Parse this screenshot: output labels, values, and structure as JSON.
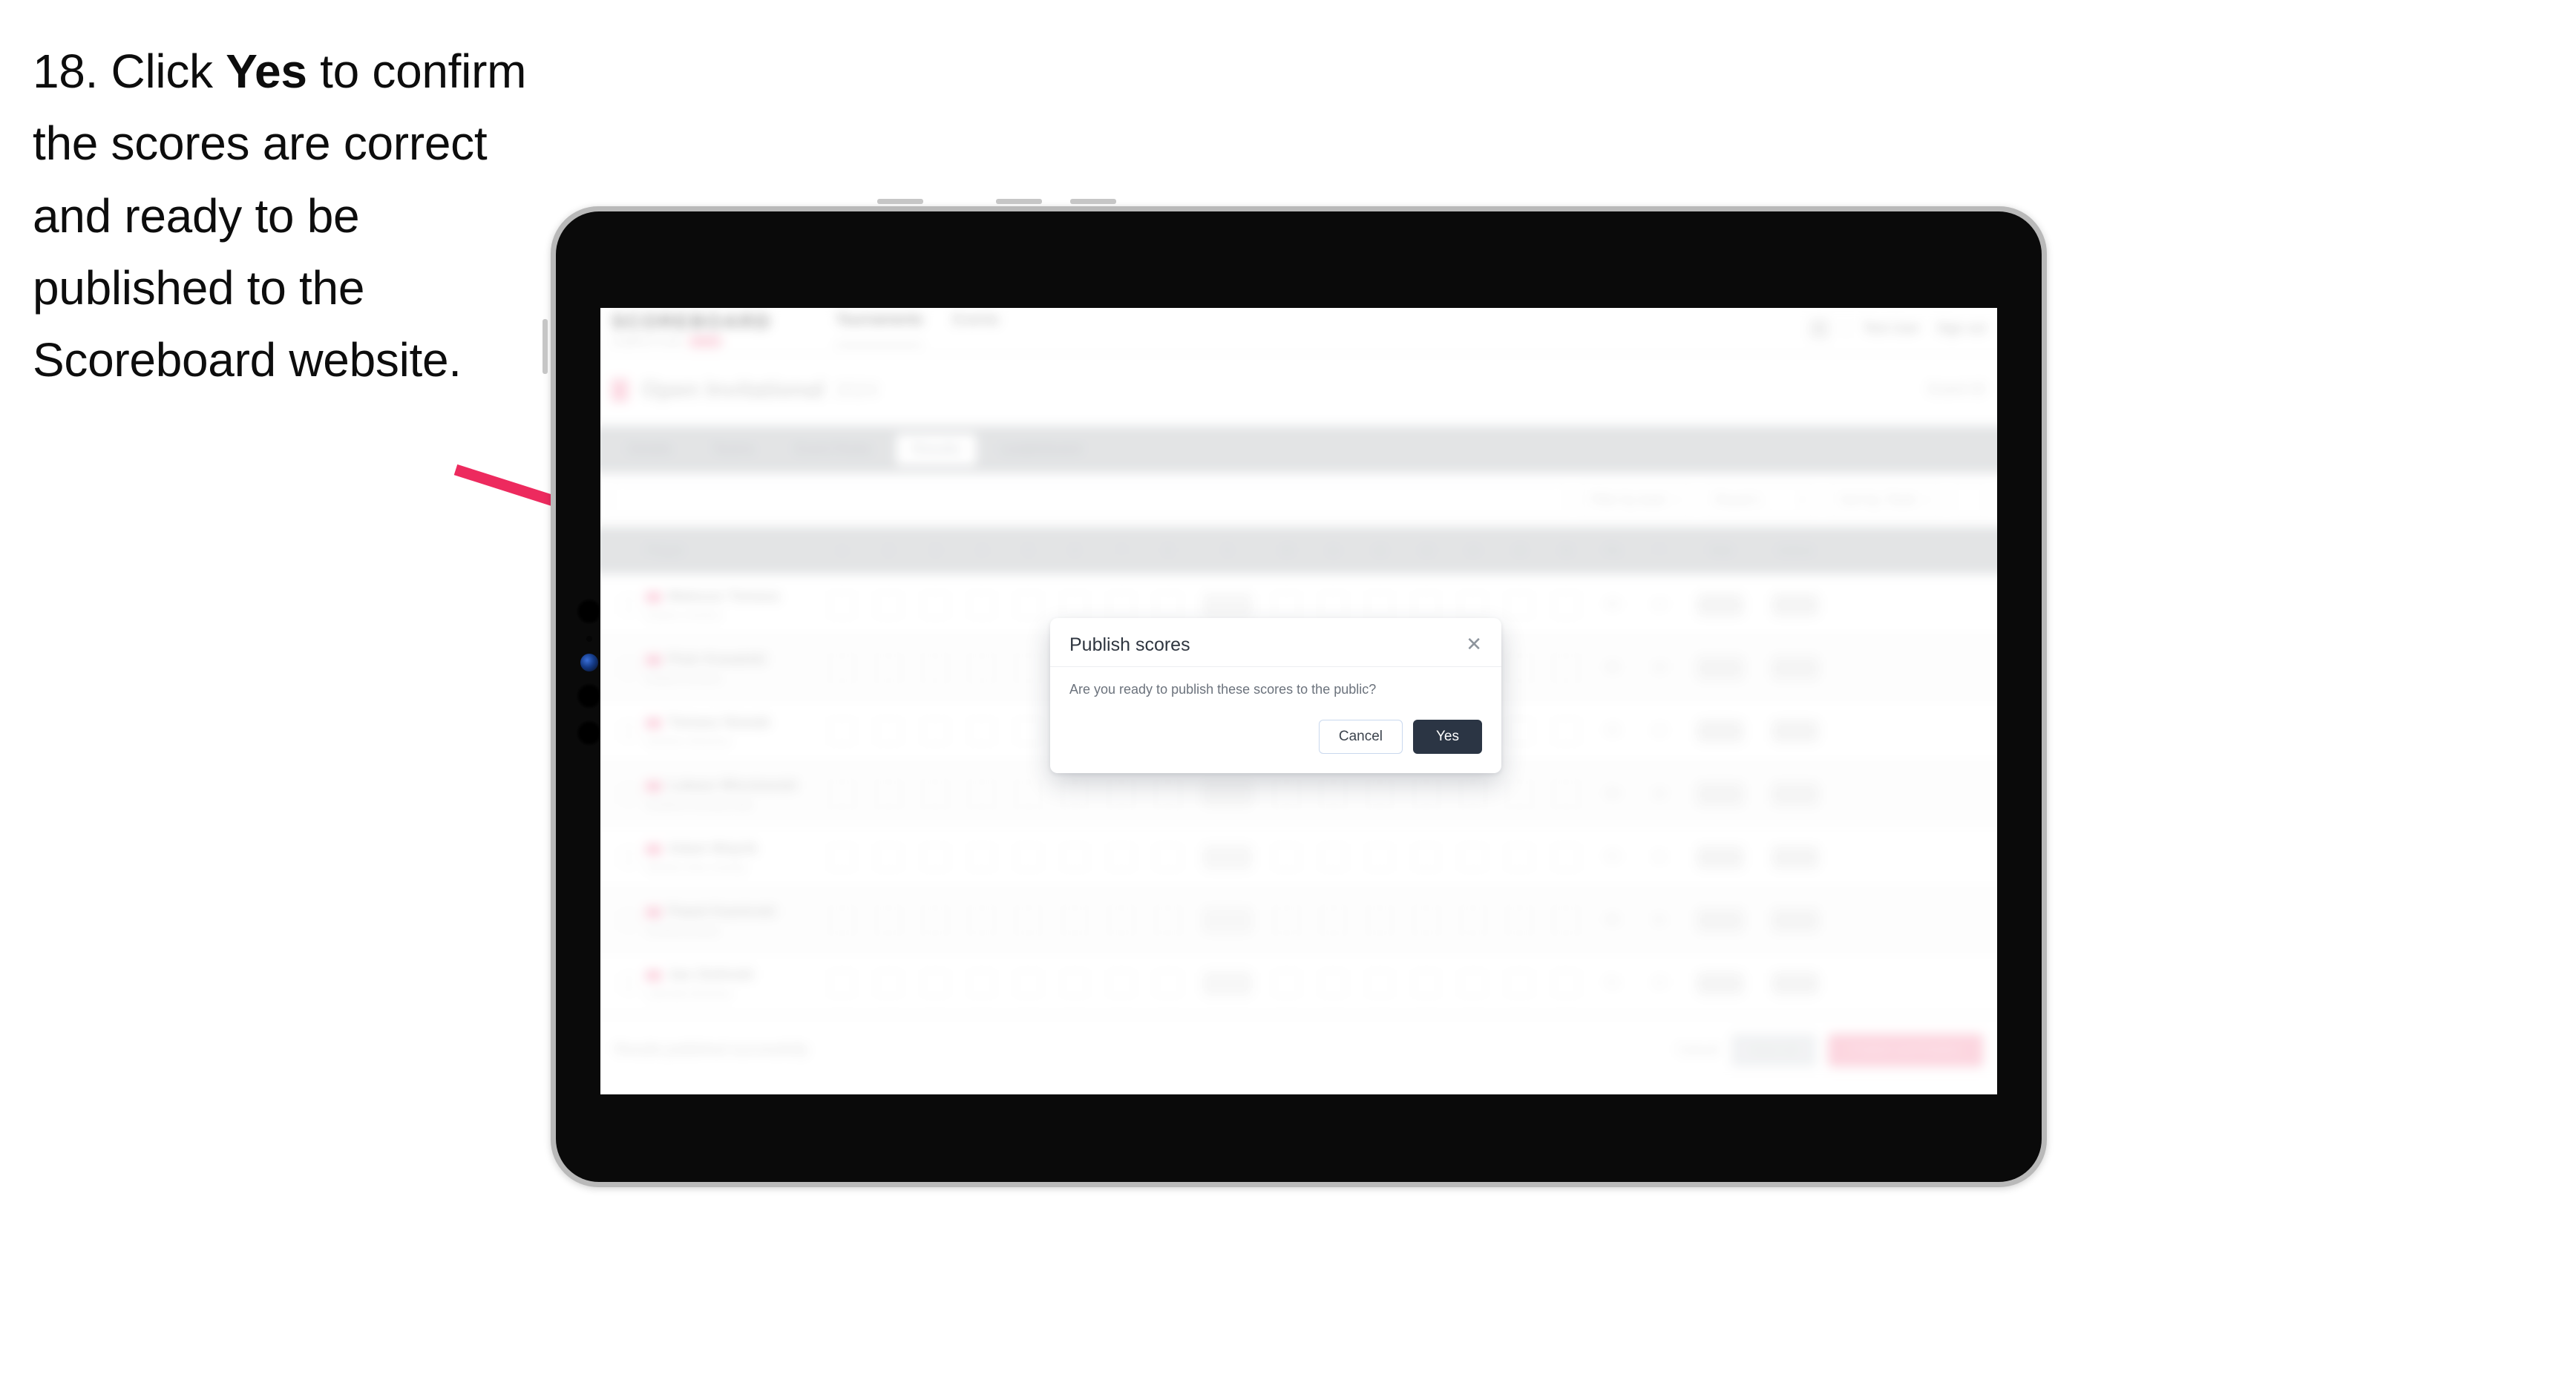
{
  "instruction": {
    "step_number": "18.",
    "before_bold": " Click ",
    "bold": "Yes",
    "after_bold": " to confirm the scores are correct and ready to be published to the Scoreboard website."
  },
  "annotation": {
    "arrow_color": "#ED2A5E",
    "arrow_name": "pointer-arrow"
  },
  "device": {
    "name": "tablet",
    "bezel_color": "#0a0a0a",
    "frame_color": "#b9b9b9"
  },
  "app": {
    "brand": {
      "name": "SCOREBOARD",
      "subtitle": "COMPETITION",
      "badge": "BETA"
    },
    "topnav": [
      {
        "label": "Tournaments"
      },
      {
        "label": "Events"
      }
    ],
    "topbar_right": {
      "user": "Test User",
      "signout": "Sign out"
    },
    "event": {
      "title": "Open Invitational",
      "subtitle": "2024",
      "right_label": "Event ID"
    },
    "tabs": [
      {
        "label": "Details"
      },
      {
        "label": "Teams"
      },
      {
        "label": "Event Rules"
      },
      {
        "label": "Results"
      },
      {
        "label": "Leaderboard"
      }
    ],
    "active_tab": "Results",
    "filters": {
      "search_placeholder": "Search",
      "selects": [
        {
          "label": "Filter by team",
          "caret": "▾"
        },
        {
          "label": "Round 1",
          "caret": "▾"
        },
        {
          "label": "Sort by: Rank",
          "caret": "▾"
        }
      ],
      "icon_button": "options-icon"
    },
    "table": {
      "headers": [
        "",
        "Player",
        "1",
        "2",
        "3",
        "4",
        "5",
        "6",
        "7",
        "8",
        "9",
        "10",
        "11",
        "12",
        "13",
        "14",
        "15",
        "16",
        "Pts",
        "T",
        "Total",
        "Actions"
      ],
      "rows": [
        {
          "name": "Mateusz Tomasz",
          "club": "Eastern Archers",
          "scores": [
            "8",
            "9",
            "8",
            "9",
            "7",
            "8",
            "9",
            "8",
            "9",
            "7",
            "8",
            "9",
            "8",
            "9",
            "7",
            "8"
          ],
          "pts": "88",
          "t": "14",
          "total": "270"
        },
        {
          "name": "Piotr Kowalski",
          "club": "Eastern Archers",
          "scores": [
            "9",
            "8",
            "9",
            "8",
            "9",
            "7",
            "8",
            "9",
            "8",
            "9",
            "7",
            "8",
            "9",
            "8",
            "9",
            "8"
          ],
          "pts": "86",
          "t": "13",
          "total": "268"
        },
        {
          "name": "Tomasz Nowak",
          "club": "Northern Bowmen",
          "scores": [
            "8",
            "8",
            "9",
            "9",
            "8",
            "8",
            "9",
            "8",
            "8",
            "9",
            "8",
            "8",
            "9",
            "8",
            "8",
            "9"
          ],
          "pts": "85",
          "t": "12",
          "total": "265"
        },
        {
          "name": "Lukasz Wisniewski",
          "club": "Southern Archery Club",
          "scores": [
            "9",
            "9",
            "8",
            "8",
            "9",
            "8",
            "8",
            "9",
            "9",
            "8",
            "8",
            "9",
            "8",
            "9",
            "8",
            "8"
          ],
          "pts": "84",
          "t": "12",
          "total": "262"
        },
        {
          "name": "Adam Wojcik",
          "club": "Western Bow Society",
          "scores": [
            "8",
            "9",
            "9",
            "8",
            "8",
            "9",
            "8",
            "8",
            "9",
            "8",
            "9",
            "8",
            "8",
            "9",
            "9",
            "8"
          ],
          "pts": "83",
          "t": "11",
          "total": "259"
        },
        {
          "name": "Pawel Kaminski",
          "club": "Central Archers",
          "scores": [
            "9",
            "8",
            "8",
            "9",
            "8",
            "8",
            "9",
            "9",
            "8",
            "8",
            "8",
            "9",
            "8",
            "8",
            "9",
            "8"
          ],
          "pts": "82",
          "t": "11",
          "total": "256"
        },
        {
          "name": "Jan Zielinski",
          "club": "Lakeside Bowmen",
          "scores": [
            "8",
            "8",
            "8",
            "9",
            "9",
            "8",
            "8",
            "8",
            "9",
            "8",
            "8",
            "8",
            "9",
            "8",
            "8",
            "9"
          ],
          "pts": "81",
          "t": "10",
          "total": "253"
        }
      ]
    },
    "bottom": {
      "note": "Results published successfully",
      "ghost": "Cancel",
      "secondary": "Save all",
      "primary": "Publish and finalise"
    }
  },
  "dialog": {
    "title": "Publish scores",
    "close_icon": "✕",
    "body": "Are you ready to publish these scores to the public?",
    "cancel_label": "Cancel",
    "confirm_label": "Yes",
    "confirm_bg": "#2b3544",
    "cancel_border": "#c9d8ee"
  }
}
